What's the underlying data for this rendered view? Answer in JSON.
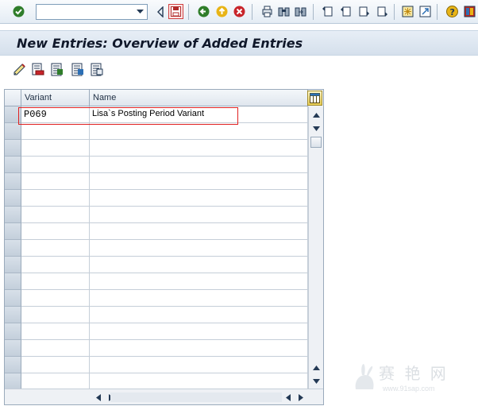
{
  "toolbar": {
    "command_field_value": "",
    "icons": [
      "check-icon",
      "command-field",
      "back-arrow-icon",
      "save-icon",
      "back-icon",
      "exit-icon",
      "cancel-icon",
      "print-icon",
      "find-icon",
      "find-next-icon",
      "first-page-icon",
      "previous-page-icon",
      "next-page-icon",
      "last-page-icon",
      "create-session-icon",
      "create-shortcut-icon",
      "help-icon",
      "customize-layout-icon"
    ]
  },
  "title": "New Entries: Overview of Added Entries",
  "app_toolbar": {
    "icons": [
      "change-icon",
      "delete-icon",
      "select-all-icon",
      "select-block-icon",
      "deselect-all-icon"
    ]
  },
  "table": {
    "columns": [
      "Variant",
      "Name"
    ],
    "rows": [
      {
        "variant": "P069",
        "name": "Lisa`s Posting Period Variant"
      }
    ],
    "empty_row_count": 16
  },
  "watermark": {
    "text": "赛 艳 网",
    "url": "www.91sap.com"
  },
  "colors": {
    "highlight": "#e02020",
    "title_bg": "#dde6f0",
    "accent": "#0f6fc6"
  }
}
